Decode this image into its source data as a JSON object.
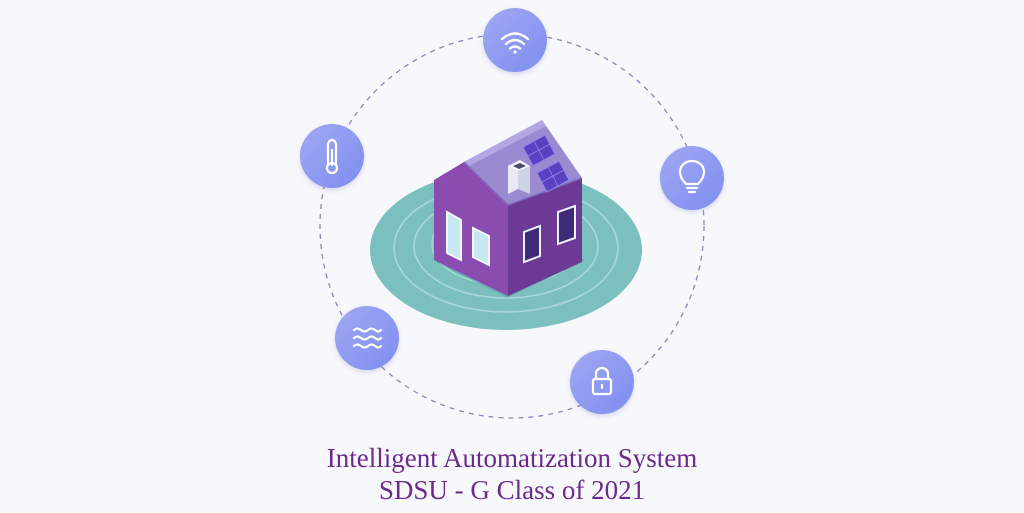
{
  "caption": {
    "title": "Intelligent Automatization System",
    "subtitle": "SDSU - G Class of 2021"
  },
  "colors": {
    "background": "#f7f8fc",
    "caption_text": "#6b2a8c",
    "node_fill_start": "#9aa6f0",
    "node_fill_end": "#7f8ef0",
    "orbit_stroke": "#8a86c4",
    "platform_outer": "#7bbfbf",
    "platform_inner": "#6fb3b5",
    "house_wall_front": "#8a4cae",
    "house_wall_side": "#6c3a94",
    "roof": "#9a8ad0",
    "solar_panel": "#5a41c4",
    "window_glass": "#c7e7f3",
    "window_dark": "#3f2a78"
  },
  "nodes": [
    {
      "name": "wifi-node",
      "icon": "wifi-icon"
    },
    {
      "name": "lightbulb-node",
      "icon": "lightbulb-icon"
    },
    {
      "name": "lock-node",
      "icon": "lock-icon"
    },
    {
      "name": "water-node",
      "icon": "water-waves-icon"
    },
    {
      "name": "thermometer-node",
      "icon": "thermometer-icon"
    }
  ]
}
